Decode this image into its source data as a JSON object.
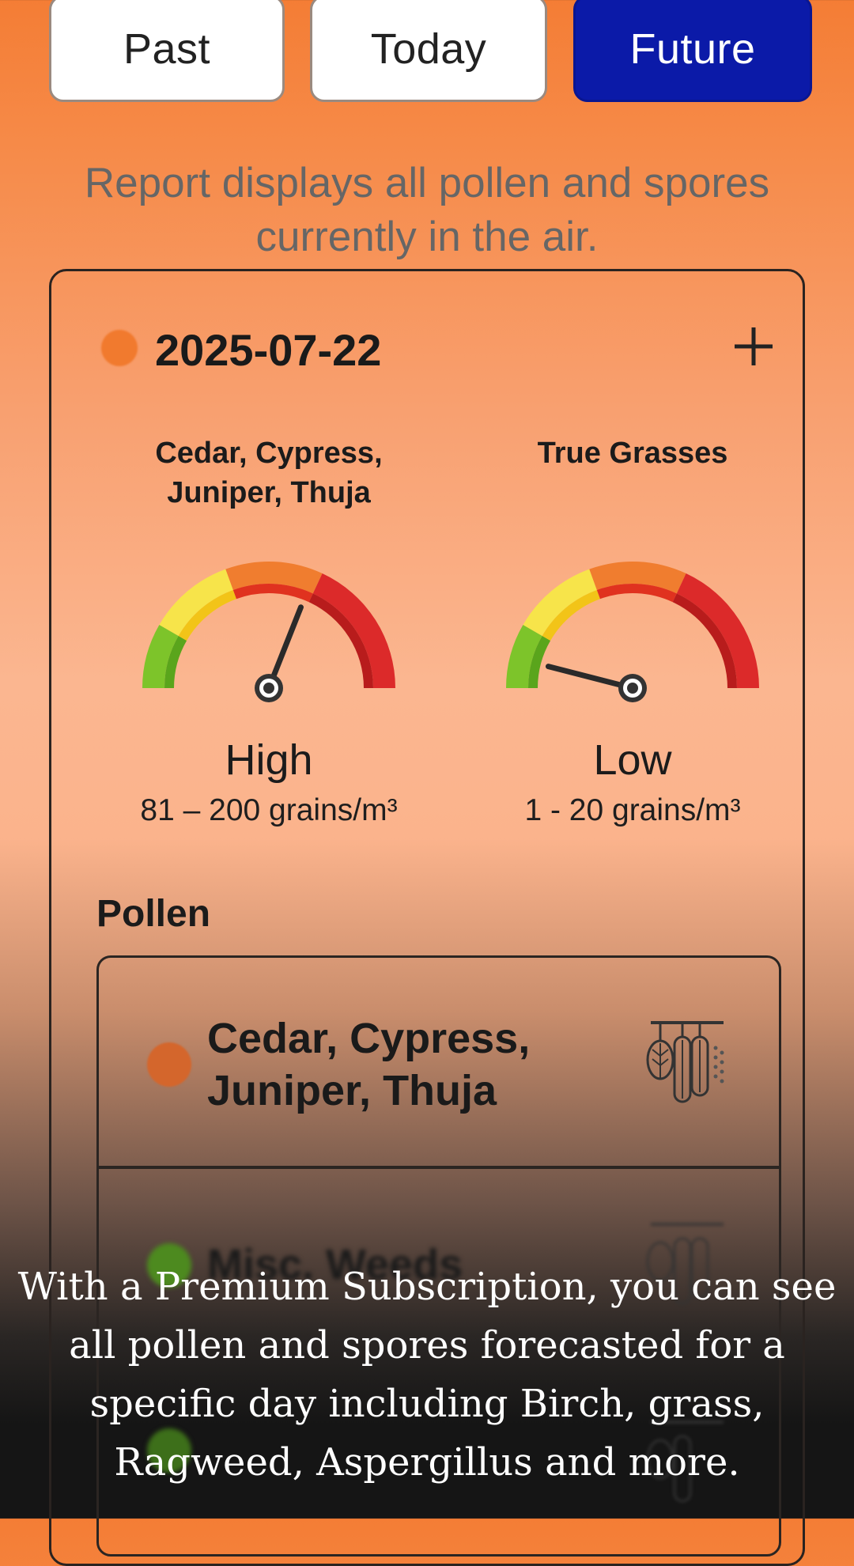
{
  "tabs": {
    "past": "Past",
    "today": "Today",
    "future": "Future",
    "active": "future"
  },
  "info_text": "Report displays all pollen and spores currently in the air.",
  "report": {
    "date": "2025-07-22",
    "status_color": "#f17a2e",
    "gauges": [
      {
        "title": "Cedar, Cypress, Juniper, Thuja",
        "level": "High",
        "range": "81 – 200 grains/m³",
        "needle_value": 0.62
      },
      {
        "title": "True Grasses",
        "level": "Low",
        "range": "1 - 20 grains/m³",
        "needle_value": 0.08
      }
    ]
  },
  "pollen_section": {
    "title": "Pollen",
    "items": [
      {
        "label": "Cedar, Cypress, Juniper, Thuja",
        "color": "#d4662c",
        "icon": "tree-pollen-icon"
      },
      {
        "label": "Misc. Weeds",
        "color": "#4d8a1f",
        "icon": "tree-pollen-icon"
      }
    ]
  },
  "promo_text": "With a Premium Subscription, you can see all pollen and spores forecasted for a specific day including Birch, grass, Ragweed, Aspergillus and more.",
  "colors": {
    "accent_blue": "#0b1aa8",
    "gauge_green": "#7dc42a",
    "gauge_yellow": "#f7e44a",
    "gauge_orange": "#f07d2f",
    "gauge_red": "#dc2a2a"
  }
}
